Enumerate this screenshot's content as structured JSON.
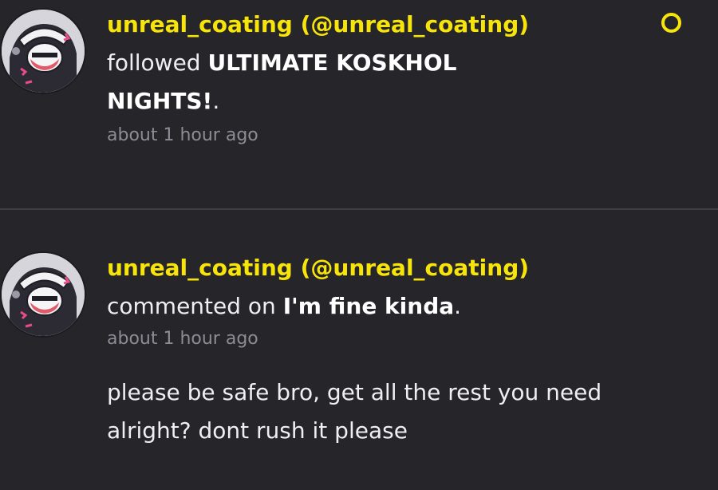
{
  "notifications": [
    {
      "username": "unreal_coating (@unreal_coating)",
      "action_prefix": "followed ",
      "target": "ULTIMATE KOSKHOL NIGHTS!",
      "action_suffix": ".",
      "time": "about 1 hour ago",
      "unread": true
    },
    {
      "username": "unreal_coating (@unreal_coating)",
      "action_prefix": "commented on ",
      "target": "I'm fine kinda",
      "action_suffix": ".",
      "time": "about 1 hour ago",
      "comment": "please be safe bro, get all the rest you need alright? dont rush it please"
    }
  ],
  "colors": {
    "background": "#26252a",
    "username": "#f6e40b",
    "text": "#efeef2",
    "timestamp": "#8d8c94",
    "divider": "#3e3d43"
  },
  "icons": {
    "unread_indicator": "unread-dot-icon",
    "avatar": "user-avatar"
  }
}
